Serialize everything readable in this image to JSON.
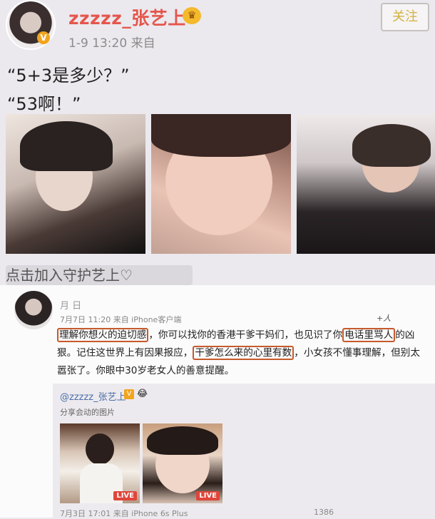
{
  "post1": {
    "username": "zzzzz_张艺上",
    "verified_icon": "v-badge-icon",
    "crown_icon": "crown-icon",
    "crown_glyph": "♛",
    "v_glyph": "V",
    "meta": "1-9 13:20  来自",
    "follow_label": "关注",
    "text_line1": "“5+3是多少？”",
    "text_line2": "“53啊！”",
    "hint": "点击加入守护艺上♡"
  },
  "post2": {
    "username": "月 日",
    "meta": "7月7日 11:20 来自 iPhone客户端",
    "margin_mark": "+人",
    "body": {
      "hl1": "理解你想火的迫切感",
      "t1": "，你可以找你的香港干爹干妈们，也见识了你",
      "hl2": "电话里骂人",
      "t2": "的凶狠。记住这世界上有因果报应，",
      "hl3": "干爹怎么来的心里有数",
      "t3": "，小女孩不懂事理解，但别太嚣张了。你眼中30岁老女人的善意提醒。"
    },
    "quoted": {
      "username": "@zzzzz_张艺上",
      "badge_glyph": "V",
      "emoji": "😂",
      "desc": "分享会动的图片",
      "live_label": "LIVE",
      "meta": "7月3日 17:01 来自 iPhone 6s Plus",
      "count": "1386"
    }
  },
  "colors": {
    "name_red": "#e5564c",
    "highlight_border": "#c65a2b",
    "link_blue": "#4a6ea8"
  }
}
